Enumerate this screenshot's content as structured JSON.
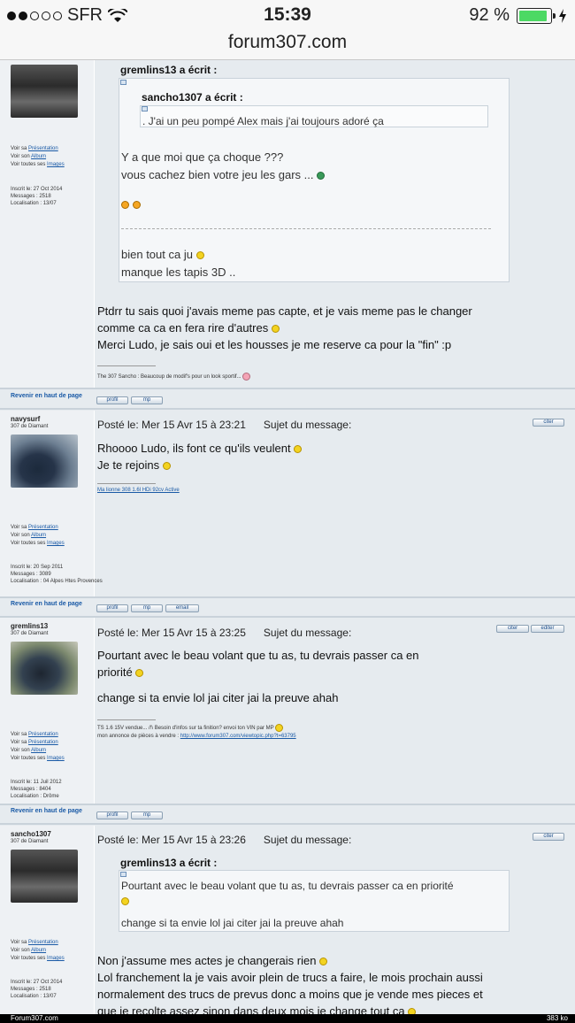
{
  "status": {
    "carrier": "SFR",
    "time": "15:39",
    "battery": "92 %",
    "battery_level": 0.92
  },
  "url": "forum307.com",
  "post1": {
    "links": [
      "Voir sa",
      "Présentation",
      "Voir son",
      "Album",
      "Voir toutes ses",
      "Images"
    ],
    "info": [
      "Inscrit le: 27 Oct 2014",
      "Messages : 2518",
      "Localisation : 13/07"
    ],
    "quote_outer_author": "gremlins13 a écrit :",
    "quote_inner_author": "sancho1307 a écrit :",
    "quote_inner_text": ". J'ai un peu pompé Alex mais j'ai toujours adoré ça",
    "quote_outer_lines": [
      "Y a que moi que ça choque ???",
      "vous cachez bien votre jeu les gars ..."
    ],
    "quote_outer_lines2": [
      "bien tout ca ju",
      "manque les tapis 3D .."
    ],
    "message": [
      "Ptdrr tu sais quoi j'avais meme pas capte, et je vais meme pas le changer",
      "comme ca ca en fera rire d'autres",
      "Merci Ludo, je sais oui et les housses je me reserve ca pour la \"fin\" :p"
    ],
    "signature": "The 307 Sancho : Beaucoup de modif's pour un look sportif...",
    "back": "Revenir en haut de page",
    "buttons": [
      "profil",
      "mp"
    ]
  },
  "post2": {
    "user": "navysurf",
    "rank": "307 de Diamant",
    "header_date": "Posté le: Mer 15 Avr 15 à 23:21",
    "header_subject": "Sujet du message:",
    "cite": "citer",
    "message": [
      "Rhoooo Ludo, ils font ce qu'ils veulent",
      "Je te rejoins"
    ],
    "signature": "Ma lionne 308 1.6l HDi 92cv Active",
    "links": [
      "Voir sa",
      "Présentation",
      "Voir son",
      "Album",
      "Voir toutes ses",
      "Images"
    ],
    "info": [
      "Inscrit le: 20 Sep 2011",
      "Messages : 3089",
      "Localisation : 04 Alpes Htes Provences"
    ],
    "back": "Revenir en haut de page",
    "buttons": [
      "profil",
      "mp",
      "email"
    ]
  },
  "post3": {
    "user": "gremlins13",
    "rank": "307 de Diamant",
    "header_date": "Posté le: Mer 15 Avr 15 à 23:25",
    "header_subject": "Sujet du message:",
    "cite": "citer",
    "edit": "editer",
    "message": [
      "Pourtant avec le beau volant que tu as, tu devrais passer ca en",
      "priorité",
      "change si ta envie lol jai citer jai la preuve ahah"
    ],
    "signature": [
      "TS 1.6 15V vendue... /!\\ Besoin d'infos sur ta finition? envoi ton VIN par MP",
      "mon annonce de pièces à vendre :",
      "http://www.forum307.com/viewtopic.php?t=63795"
    ],
    "links": [
      "Voir sa",
      "Présentation",
      "Voir sa",
      "Présentation",
      "Voir son",
      "Album",
      "Voir toutes ses",
      "Images"
    ],
    "info": [
      "Inscrit le: 11 Juil 2012",
      "Messages : 8404",
      "Localisation : Drôme"
    ],
    "back": "Revenir en haut de page",
    "buttons": [
      "profil",
      "mp"
    ]
  },
  "post4": {
    "user": "sancho1307",
    "rank": "307 de Diamant",
    "header_date": "Posté le: Mer 15 Avr 15 à 23:26",
    "header_subject": "Sujet du message:",
    "cite": "citer",
    "quote_author": "gremlins13 a écrit :",
    "quote_lines": [
      "Pourtant avec le beau volant que tu as, tu devrais passer ca en priorité",
      "change si ta envie lol jai citer jai la preuve ahah"
    ],
    "message": [
      "Non j'assume mes actes je changerais rien",
      "Lol franchement la je vais avoir plein de trucs a faire, le mois prochain aussi",
      "normalement des trucs de prevus donc a moins que je vende mes pieces et",
      "que je recolte assez sinon dans deux mois je change tout ca"
    ],
    "links": [
      "Voir sa",
      "Présentation",
      "Voir son",
      "Album",
      "Voir toutes ses",
      "Images"
    ],
    "info": [
      "Inscrit le: 27 Oct 2014",
      "Messages : 2518",
      "Localisation : 13/07"
    ]
  },
  "footer": {
    "left": "Forum307.com",
    "right": "383 ko"
  }
}
